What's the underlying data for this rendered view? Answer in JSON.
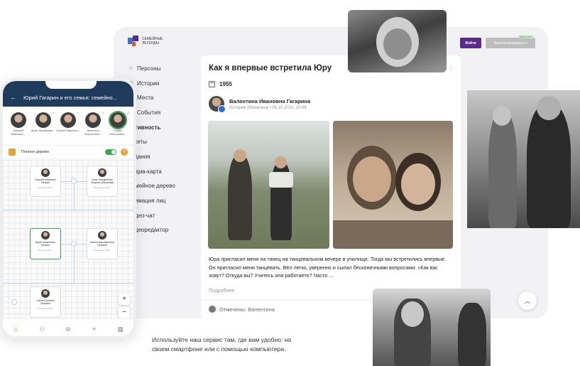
{
  "header": {
    "logo_text": "СЕМЕЙНЫЕ ЛЕГЕНДЫ",
    "login_button": "Войти",
    "register_button": "Зарегистрироваться",
    "beta_badge": "Бета-тест"
  },
  "sidebar": {
    "items": [
      {
        "label": "Персоны",
        "icon": "people-icon"
      },
      {
        "label": "Истории",
        "icon": "book-icon"
      },
      {
        "label": "Места",
        "icon": "pin-icon"
      },
      {
        "label": "События",
        "icon": "calendar-icon"
      },
      {
        "label": "Активность",
        "icon": ""
      },
      {
        "label": "Анкеты",
        "icon": ""
      },
      {
        "label": "Задания",
        "icon": ""
      },
      {
        "label": "Медиа-карта",
        "icon": ""
      },
      {
        "label": "Семейное дерево",
        "icon": ""
      },
      {
        "label": "Анимация лиц",
        "icon": ""
      },
      {
        "label": "Видео-чат",
        "icon": ""
      },
      {
        "label": "Видеоредактор",
        "icon": ""
      }
    ]
  },
  "story": {
    "title": "Как я впервые встретила Юру",
    "year": "1955",
    "author_name": "Валентина Ивановна Гагарина",
    "author_meta": "История обновлена • 05.10.2021, 19:09",
    "text": "Юра пригласил меня на танец на танцевальном вечере в училище. Тогда мы встретились впервые. Он пригласил меня танцевать. Вёл легко, уверенно и сыпал бесконечными вопросами: «Как вас зовут? Откуда вы? Учитесь или работаете? Часто ...",
    "more_link": "Подробнее",
    "marked": "Отмечены: Валентина"
  },
  "phone": {
    "title": "Юрий Гагарин и его семья: семейно...",
    "people": [
      {
        "name": "Алексей Иванович...",
        "badge": ""
      },
      {
        "name": "Анна Тимофеевн...",
        "badge": "4"
      },
      {
        "name": "Сергей Павлович...",
        "badge": "1"
      },
      {
        "name": "Валентин Алексеевич...",
        "badge": "1"
      },
      {
        "name": "Юрий Алексеевич...",
        "badge": "4"
      }
    ],
    "tree_label": "Полное дерево",
    "tree_nodes": [
      {
        "name": "Алексей Иванович Гагарин",
        "date": "11 марта 1902 г."
      },
      {
        "name": "Анна Тимофеевна Гагарина (Матвеева)",
        "date": "18 декабря 1903 г."
      },
      {
        "name": "Юрий Алексеевич Гагарин",
        "date": "9 марта 1934 г."
      },
      {
        "name": "Валентина Ивановна Гагарина",
        "date": "15 декабря 1935 г."
      },
      {
        "name": "Елена Юрьевна Гагарина",
        "date": "17 апреля 1959 г."
      }
    ],
    "zoom_in": "+",
    "zoom_out": "−"
  },
  "caption": "Используйте наш сервис там, где вам удобно: на своем смартфоне или с помощью компьютера.",
  "colors": {
    "brand_purple": "#5b2b8a",
    "phone_header": "#1f3b5c",
    "accent_green": "#3aa84a",
    "accent_orange": "#e05a2a"
  }
}
